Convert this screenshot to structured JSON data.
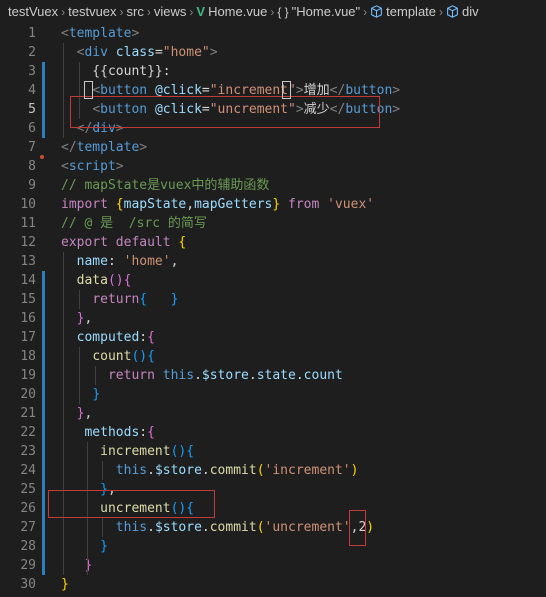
{
  "breadcrumb": {
    "items": [
      {
        "label": "testVuex",
        "icon": null
      },
      {
        "label": "testvuex",
        "icon": null
      },
      {
        "label": "src",
        "icon": null
      },
      {
        "label": "views",
        "icon": null
      },
      {
        "label": "Home.vue",
        "icon": "vue-icon"
      },
      {
        "label": "\"Home.vue\"",
        "icon": "braces-icon"
      },
      {
        "label": "template",
        "icon": "cube-icon"
      },
      {
        "label": "div",
        "icon": "cube-icon"
      }
    ]
  },
  "editor": {
    "active_line": 5,
    "lines": [
      {
        "n": "1",
        "t": [
          [
            "t-brk",
            "<"
          ],
          [
            "t-tag",
            "template"
          ],
          [
            "t-brk",
            ">"
          ]
        ]
      },
      {
        "n": "2",
        "t": [
          [
            "t-txt",
            "  "
          ],
          [
            "t-brk",
            "<"
          ],
          [
            "t-tag",
            "div"
          ],
          [
            "t-txt",
            " "
          ],
          [
            "t-attr",
            "class"
          ],
          [
            "t-txt",
            "="
          ],
          [
            "t-str",
            "\"home\""
          ],
          [
            "t-brk",
            ">"
          ]
        ]
      },
      {
        "n": "3",
        "t": [
          [
            "t-txt",
            "    {{count}}:"
          ]
        ]
      },
      {
        "n": "4",
        "t": [
          [
            "t-txt",
            "    "
          ],
          [
            "t-brk",
            "<"
          ],
          [
            "t-tag",
            "button"
          ],
          [
            "t-txt",
            " "
          ],
          [
            "t-attr",
            "@click"
          ],
          [
            "t-txt",
            "="
          ],
          [
            "t-str",
            "\"increment\""
          ],
          [
            "t-brk",
            ">"
          ],
          [
            "t-txt",
            "增加"
          ],
          [
            "t-brk",
            "</"
          ],
          [
            "t-tag",
            "button"
          ],
          [
            "t-brk",
            ">"
          ]
        ]
      },
      {
        "n": "5",
        "t": [
          [
            "t-txt",
            "    "
          ],
          [
            "t-brk",
            "<"
          ],
          [
            "t-tag",
            "button"
          ],
          [
            "t-txt",
            " "
          ],
          [
            "t-attr",
            "@click"
          ],
          [
            "t-txt",
            "="
          ],
          [
            "t-str",
            "\"uncrement\""
          ],
          [
            "t-brk",
            ">"
          ],
          [
            "t-txt",
            "减少"
          ],
          [
            "t-brk",
            "</"
          ],
          [
            "t-tag",
            "button"
          ],
          [
            "t-brk",
            ">"
          ]
        ]
      },
      {
        "n": "6",
        "t": [
          [
            "t-txt",
            "  "
          ],
          [
            "t-brk",
            "</"
          ],
          [
            "t-tag",
            "div"
          ],
          [
            "t-brk",
            ">"
          ]
        ]
      },
      {
        "n": "7",
        "t": [
          [
            "t-brk",
            "</"
          ],
          [
            "t-tag",
            "template"
          ],
          [
            "t-brk",
            ">"
          ]
        ]
      },
      {
        "n": "8",
        "t": [
          [
            "t-brk",
            "<"
          ],
          [
            "t-tag",
            "script"
          ],
          [
            "t-brk",
            ">"
          ]
        ]
      },
      {
        "n": "9",
        "t": [
          [
            "t-cmt",
            "// mapState是vuex中的辅助函数"
          ]
        ]
      },
      {
        "n": "10",
        "t": [
          [
            "t-kw",
            "import"
          ],
          [
            "t-txt",
            " "
          ],
          [
            "t-b1",
            "{"
          ],
          [
            "t-var",
            "mapState"
          ],
          [
            "t-txt",
            ","
          ],
          [
            "t-var",
            "mapGetters"
          ],
          [
            "t-b1",
            "}"
          ],
          [
            "t-txt",
            " "
          ],
          [
            "t-kw",
            "from"
          ],
          [
            "t-txt",
            " "
          ],
          [
            "t-str",
            "'vuex'"
          ]
        ]
      },
      {
        "n": "11",
        "t": [
          [
            "t-cmt",
            "// @ 是  /src 的简写"
          ]
        ]
      },
      {
        "n": "12",
        "t": [
          [
            "t-kw",
            "export"
          ],
          [
            "t-txt",
            " "
          ],
          [
            "t-kw",
            "default"
          ],
          [
            "t-txt",
            " "
          ],
          [
            "t-b1",
            "{"
          ]
        ]
      },
      {
        "n": "13",
        "t": [
          [
            "t-txt",
            "  "
          ],
          [
            "t-var",
            "name"
          ],
          [
            "t-txt",
            ": "
          ],
          [
            "t-str",
            "'home'"
          ],
          [
            "t-txt",
            ","
          ]
        ]
      },
      {
        "n": "14",
        "t": [
          [
            "t-txt",
            "  "
          ],
          [
            "t-fn",
            "data"
          ],
          [
            "t-b2",
            "()"
          ],
          [
            "t-b2",
            "{"
          ]
        ]
      },
      {
        "n": "15",
        "t": [
          [
            "t-txt",
            "    "
          ],
          [
            "t-kw",
            "return"
          ],
          [
            "t-b3",
            "{"
          ],
          [
            "t-txt",
            "   "
          ],
          [
            "t-b3",
            "}"
          ]
        ]
      },
      {
        "n": "16",
        "t": [
          [
            "t-txt",
            "  "
          ],
          [
            "t-b2",
            "}"
          ],
          [
            "t-txt",
            ","
          ]
        ]
      },
      {
        "n": "17",
        "t": [
          [
            "t-txt",
            "  "
          ],
          [
            "t-var",
            "computed"
          ],
          [
            "t-txt",
            ":"
          ],
          [
            "t-b2",
            "{"
          ]
        ]
      },
      {
        "n": "18",
        "t": [
          [
            "t-txt",
            "    "
          ],
          [
            "t-fn",
            "count"
          ],
          [
            "t-b3",
            "()"
          ],
          [
            "t-b3",
            "{"
          ]
        ]
      },
      {
        "n": "19",
        "t": [
          [
            "t-txt",
            "      "
          ],
          [
            "t-kw",
            "return"
          ],
          [
            "t-txt",
            " "
          ],
          [
            "t-kw2",
            "this"
          ],
          [
            "t-txt",
            "."
          ],
          [
            "t-var",
            "$store"
          ],
          [
            "t-txt",
            "."
          ],
          [
            "t-var",
            "state"
          ],
          [
            "t-txt",
            "."
          ],
          [
            "t-var",
            "count"
          ]
        ]
      },
      {
        "n": "20",
        "t": [
          [
            "t-txt",
            "    "
          ],
          [
            "t-b3",
            "}"
          ]
        ]
      },
      {
        "n": "21",
        "t": [
          [
            "t-txt",
            "  "
          ],
          [
            "t-b2",
            "}"
          ],
          [
            "t-txt",
            ","
          ]
        ]
      },
      {
        "n": "22",
        "t": [
          [
            "t-txt",
            "   "
          ],
          [
            "t-var",
            "methods"
          ],
          [
            "t-txt",
            ":"
          ],
          [
            "t-b2",
            "{"
          ]
        ]
      },
      {
        "n": "23",
        "t": [
          [
            "t-txt",
            "     "
          ],
          [
            "t-fn",
            "increment"
          ],
          [
            "t-b3",
            "()"
          ],
          [
            "t-b3",
            "{"
          ]
        ]
      },
      {
        "n": "24",
        "t": [
          [
            "t-txt",
            "       "
          ],
          [
            "t-kw2",
            "this"
          ],
          [
            "t-txt",
            "."
          ],
          [
            "t-var",
            "$store"
          ],
          [
            "t-txt",
            "."
          ],
          [
            "t-fn",
            "commit"
          ],
          [
            "t-b1",
            "("
          ],
          [
            "t-str",
            "'increment'"
          ],
          [
            "t-b1",
            ")"
          ]
        ]
      },
      {
        "n": "25",
        "t": [
          [
            "t-txt",
            "     "
          ],
          [
            "t-b3",
            "}"
          ],
          [
            "t-txt",
            ","
          ]
        ]
      },
      {
        "n": "26",
        "t": [
          [
            "t-txt",
            "     "
          ],
          [
            "t-fn",
            "uncrement"
          ],
          [
            "t-b3",
            "()"
          ],
          [
            "t-b3",
            "{"
          ]
        ]
      },
      {
        "n": "27",
        "t": [
          [
            "t-txt",
            "       "
          ],
          [
            "t-kw2",
            "this"
          ],
          [
            "t-txt",
            "."
          ],
          [
            "t-var",
            "$store"
          ],
          [
            "t-txt",
            "."
          ],
          [
            "t-fn",
            "commit"
          ],
          [
            "t-b1",
            "("
          ],
          [
            "t-str",
            "'uncrement'"
          ],
          [
            "t-txt",
            ","
          ],
          [
            "t-txt",
            "2"
          ],
          [
            "t-b1",
            ")"
          ]
        ]
      },
      {
        "n": "28",
        "t": [
          [
            "t-txt",
            "     "
          ],
          [
            "t-b3",
            "}"
          ]
        ]
      },
      {
        "n": "29",
        "t": [
          [
            "t-txt",
            "   "
          ],
          [
            "t-b2",
            "}"
          ]
        ]
      },
      {
        "n": "30",
        "t": [
          [
            "t-b1",
            "}"
          ]
        ]
      }
    ]
  },
  "colors": {
    "background": "#1e1e1e",
    "highlight_box": "#c23b3b",
    "git_modified_bar": "#2a7fbd"
  }
}
